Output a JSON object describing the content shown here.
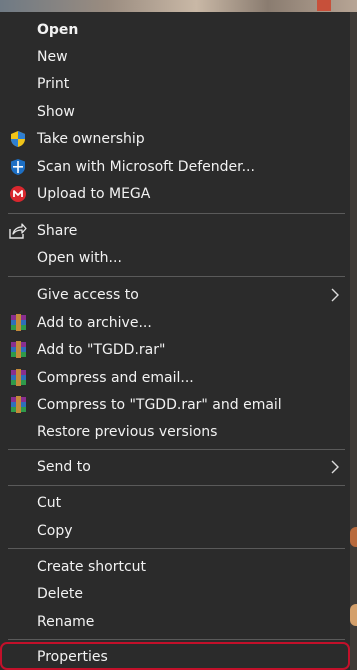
{
  "menu": {
    "open": "Open",
    "new": "New",
    "print": "Print",
    "show": "Show",
    "take_ownership": "Take ownership",
    "scan_defender": "Scan with Microsoft Defender...",
    "upload_mega": "Upload to MEGA",
    "share": "Share",
    "open_with": "Open with...",
    "give_access": "Give access to",
    "add_to_archive": "Add to archive...",
    "add_to_rar": "Add to \"TGDD.rar\"",
    "compress_email": "Compress and email...",
    "compress_rar_email": "Compress to \"TGDD.rar\" and email",
    "restore_versions": "Restore previous versions",
    "send_to": "Send to",
    "cut": "Cut",
    "copy": "Copy",
    "create_shortcut": "Create shortcut",
    "delete": "Delete",
    "rename": "Rename",
    "properties": "Properties"
  },
  "icons": {
    "take_ownership": "uac-shield-icon",
    "scan_defender": "defender-shield-icon",
    "upload_mega": "mega-icon",
    "share": "share-icon",
    "winrar": "winrar-icon"
  },
  "colors": {
    "menu_bg": "#2b2b2b",
    "text": "#f2f2f2",
    "separator": "#5a5a5a",
    "highlight_border": "#c3102a",
    "mega_red": "#d9272e",
    "defender_blue": "#1d6fc4"
  }
}
